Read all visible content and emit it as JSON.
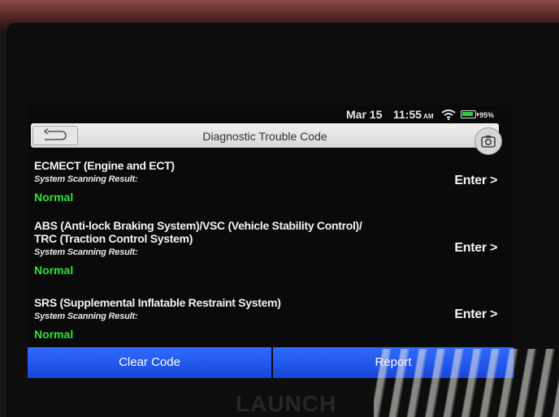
{
  "status_bar": {
    "date": "Mar 15",
    "time": "11:55",
    "ampm": "AM",
    "battery_percent": "95%",
    "battery_level": 0.95,
    "icons": [
      "wifi-icon",
      "battery-icon"
    ]
  },
  "header": {
    "title": "Diagnostic Trouble Code",
    "back_icon": "back-arrow-icon",
    "camera_icon": "camera-icon"
  },
  "systems": [
    {
      "name": "ECMECT (Engine and ECT)",
      "result_label": "System Scanning Result:",
      "result": "Normal",
      "action": "Enter >"
    },
    {
      "name": "ABS (Anti-lock Braking System)/VSC (Vehicle Stability Control)/\nTRC (Traction Control System)",
      "result_label": "System Scanning Result:",
      "result": "Normal",
      "action": "Enter >"
    },
    {
      "name": "SRS (Supplemental Inflatable Restraint System)",
      "result_label": "System Scanning Result:",
      "result": "Normal",
      "action": "Enter >"
    }
  ],
  "footer": {
    "clear_label": "Clear Code",
    "report_label": "Report"
  },
  "device": {
    "brand": "LAUNCH"
  },
  "colors": {
    "normal_status": "#2fe03a",
    "button_blue": "#1f55e8",
    "screen_bg": "#0a0a0a"
  }
}
